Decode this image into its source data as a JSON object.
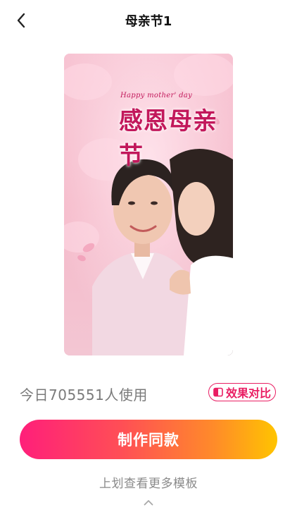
{
  "header": {
    "title": "母亲节1",
    "back_icon": "chevron-left-icon"
  },
  "preview": {
    "english_text": "Happy mother' day",
    "chinese_text": "感恩母亲节",
    "favorite_icon": "heart-icon",
    "colors": {
      "background": "#f5c8d4",
      "title": "#c2185b"
    }
  },
  "stats": {
    "usage_text": "今日705551人使用"
  },
  "compare": {
    "label": "效果对比",
    "icon": "compare-icon",
    "color": "#e91e63"
  },
  "actions": {
    "make_label": "制作同款",
    "gradient": [
      "#ff1f7a",
      "#ffc400"
    ]
  },
  "footer": {
    "swipe_hint": "上划查看更多模板",
    "arrow_icon": "chevron-up-icon"
  }
}
